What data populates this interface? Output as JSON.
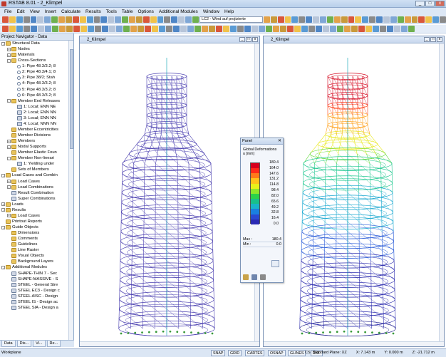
{
  "window": {
    "title": "RSTAB 8.01 - 2_Klimpel"
  },
  "menu": [
    "File",
    "Edit",
    "View",
    "Insert",
    "Calculate",
    "Results",
    "Tools",
    "Table",
    "Options",
    "Additional Modules",
    "Window",
    "Help"
  ],
  "toolbar": {
    "loadcase": "LC2 - Wind auf projizierte"
  },
  "navigator": {
    "title": "Project Navigator - Data",
    "tabs": [
      "Data",
      "Dis...",
      "Vi...",
      "Re..."
    ],
    "items": [
      {
        "t": "Structural Data",
        "l": 1,
        "e": "-",
        "i": "fold"
      },
      {
        "t": "Nodes",
        "l": 2,
        "e": "+",
        "i": "fold"
      },
      {
        "t": "Materials",
        "l": 2,
        "e": "+",
        "i": "fold"
      },
      {
        "t": "Cross-Sections",
        "l": 2,
        "e": "-",
        "i": "fold"
      },
      {
        "t": "1: Pipe 48.3/3.2; 8",
        "l": 3,
        "e": "",
        "i": "dot"
      },
      {
        "t": "2: Pipe 48.3/4.1; 8",
        "l": 3,
        "e": "",
        "i": "dot"
      },
      {
        "t": "3: Pipe 38/2; Stah",
        "l": 3,
        "e": "",
        "i": "dot"
      },
      {
        "t": "4: Pipe 48.3/3.2; 8",
        "l": 3,
        "e": "",
        "i": "dot"
      },
      {
        "t": "5: Pipe 48.3/3.2; 8",
        "l": 3,
        "e": "",
        "i": "dot"
      },
      {
        "t": "6: Pipe 48.3/3.2; 8",
        "l": 3,
        "e": "",
        "i": "dot"
      },
      {
        "t": "Member End Releases",
        "l": 2,
        "e": "-",
        "i": "fold"
      },
      {
        "t": "1: Local; ENN NE",
        "l": 3,
        "e": "",
        "i": "mod"
      },
      {
        "t": "2: Local; ENN NN",
        "l": 3,
        "e": "",
        "i": "mod"
      },
      {
        "t": "3: Local; ENN NN",
        "l": 3,
        "e": "",
        "i": "mod"
      },
      {
        "t": "4: Local; NNN NN",
        "l": 3,
        "e": "",
        "i": "mod"
      },
      {
        "t": "Member Eccentricities",
        "l": 2,
        "e": "",
        "i": "fold"
      },
      {
        "t": "Member Divisions",
        "l": 2,
        "e": "",
        "i": "fold"
      },
      {
        "t": "Members",
        "l": 2,
        "e": "+",
        "i": "fold"
      },
      {
        "t": "Nodal Supports",
        "l": 2,
        "e": "+",
        "i": "fold"
      },
      {
        "t": "Member Elastic Foun",
        "l": 2,
        "e": "",
        "i": "fold"
      },
      {
        "t": "Member Non-lineari",
        "l": 2,
        "e": "-",
        "i": "fold"
      },
      {
        "t": "1: Yielding under",
        "l": 3,
        "e": "",
        "i": "mod"
      },
      {
        "t": "Sets of Members",
        "l": 2,
        "e": "",
        "i": "fold"
      },
      {
        "t": "Load Cases and Combin",
        "l": 1,
        "e": "-",
        "i": "fold"
      },
      {
        "t": "Load Cases",
        "l": 2,
        "e": "+",
        "i": "fold"
      },
      {
        "t": "Load Combinations",
        "l": 2,
        "e": "+",
        "i": "fold"
      },
      {
        "t": "Result Combination",
        "l": 2,
        "e": "",
        "i": "mod"
      },
      {
        "t": "Super Combinations",
        "l": 2,
        "e": "",
        "i": "mod"
      },
      {
        "t": "Loads",
        "l": 1,
        "e": "+",
        "i": "fold"
      },
      {
        "t": "Results",
        "l": 1,
        "e": "-",
        "i": "fold"
      },
      {
        "t": "Load Cases",
        "l": 2,
        "e": "+",
        "i": "fold"
      },
      {
        "t": "Printout Reports",
        "l": 1,
        "e": "",
        "i": "fold"
      },
      {
        "t": "Guide Objects",
        "l": 1,
        "e": "-",
        "i": "fold"
      },
      {
        "t": "Dimensions",
        "l": 2,
        "e": "",
        "i": "fold"
      },
      {
        "t": "Comments",
        "l": 2,
        "e": "",
        "i": "fold"
      },
      {
        "t": "Guidelines",
        "l": 2,
        "e": "",
        "i": "fold"
      },
      {
        "t": "Line Raster",
        "l": 2,
        "e": "",
        "i": "fold"
      },
      {
        "t": "Visual Objects",
        "l": 2,
        "e": "",
        "i": "fold"
      },
      {
        "t": "Background Layers",
        "l": 2,
        "e": "",
        "i": "fold"
      },
      {
        "t": "Additional Modules",
        "l": 1,
        "e": "-",
        "i": "fold"
      },
      {
        "t": "SHAPE-THIN 7 - Sec",
        "l": 2,
        "e": "",
        "i": "mod"
      },
      {
        "t": "SHAPE-MASSIVE - S",
        "l": 2,
        "e": "",
        "i": "mod"
      },
      {
        "t": "STEEL - General Stre",
        "l": 2,
        "e": "",
        "i": "mod"
      },
      {
        "t": "STEEL EC3 - Design c",
        "l": 2,
        "e": "",
        "i": "mod"
      },
      {
        "t": "STEEL AISC - Design",
        "l": 2,
        "e": "",
        "i": "mod"
      },
      {
        "t": "STEEL IS - Design ac",
        "l": 2,
        "e": "",
        "i": "mod"
      },
      {
        "t": "STEEL SIA - Design a",
        "l": 2,
        "e": "",
        "i": "mod"
      }
    ]
  },
  "view_left": {
    "title": "2_Klimpel"
  },
  "view_right": {
    "title": "2_Klimpel"
  },
  "panel": {
    "title": "Panel",
    "heading1": "Global Deformations",
    "heading2": "u [mm]",
    "values": [
      "180.4",
      "164.0",
      "147.6",
      "131.2",
      "114.8",
      "98.4",
      "82.0",
      "65.6",
      "49.2",
      "32.8",
      "16.4",
      "0.0"
    ],
    "colors": [
      "#d6001c",
      "#ff2a1a",
      "#ff7a1a",
      "#ffc21a",
      "#e8f01a",
      "#8fe82a",
      "#2cd24a",
      "#19c08a",
      "#19b4c8",
      "#1a7fe0",
      "#2a48d2",
      "#2a2ab4"
    ],
    "max_label": "Max :",
    "max_value": "180.4",
    "min_label": "Min :",
    "min_value": "0.0"
  },
  "status": {
    "left": "Workplane",
    "modes": [
      "SNAP",
      "GRID",
      "CARTES",
      "OSNAP",
      "GLINES",
      "DXF"
    ],
    "cs": "CS: Standard  Plane: XZ",
    "x": "X:  7.143 m",
    "y": "Y:  0.000 m",
    "z": "Z: -21.712 m"
  }
}
